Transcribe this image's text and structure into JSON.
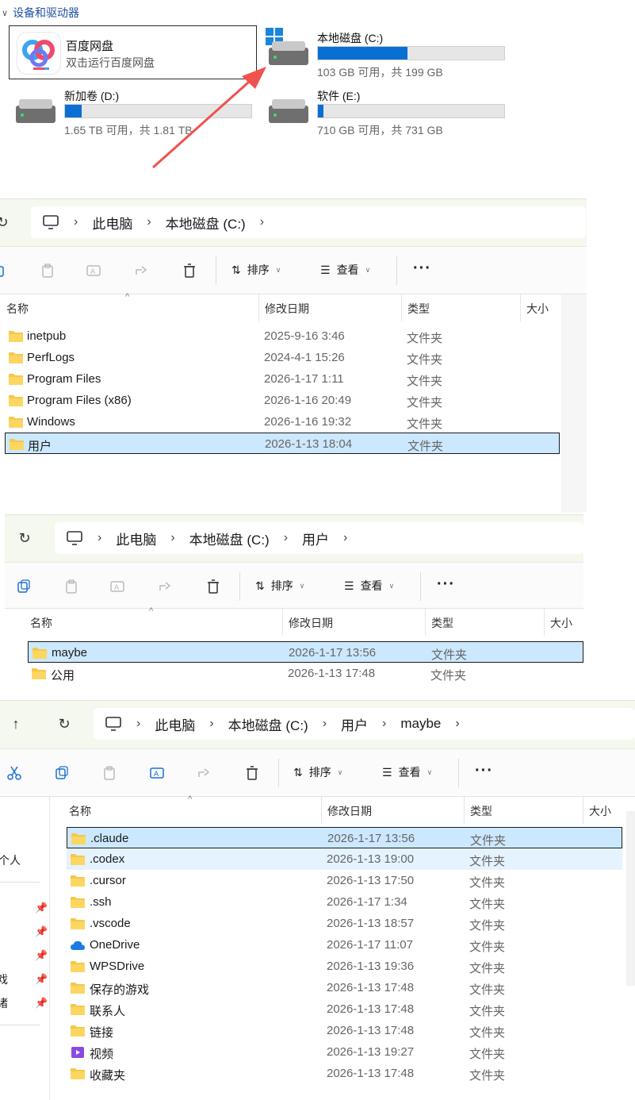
{
  "drives_section": {
    "header": "设备和驱动器",
    "baidu": {
      "name": "百度网盘",
      "subtitle": "双击运行百度网盘"
    },
    "drives": [
      {
        "name": "本地磁盘 (C:)",
        "size": "103 GB 可用，共 199 GB",
        "used_fraction": 0.48
      },
      {
        "name": "新加卷 (D:)",
        "size": "1.65 TB 可用，共 1.81 TB",
        "used_fraction": 0.09
      },
      {
        "name": "软件 (E:)",
        "size": "710 GB 可用，共 731 GB",
        "used_fraction": 0.03
      }
    ],
    "colors": {
      "accent": "#0a6fd2",
      "arrow": "#f0524d"
    }
  },
  "toolbar": {
    "sort_label": "排序",
    "view_label": "查看",
    "more_label": "···"
  },
  "columns": {
    "name": "名称",
    "date": "修改日期",
    "type": "类型",
    "size": "大小"
  },
  "window1": {
    "breadcrumbs": [
      "此电脑",
      "本地磁盘 (C:)"
    ],
    "rows": [
      {
        "name": "inetpub",
        "date": "2025-9-16 3:46",
        "type": "文件夹"
      },
      {
        "name": "PerfLogs",
        "date": "2024-4-1 15:26",
        "type": "文件夹"
      },
      {
        "name": "Program Files",
        "date": "2026-1-17 1:11",
        "type": "文件夹"
      },
      {
        "name": "Program Files (x86)",
        "date": "2026-1-16 20:49",
        "type": "文件夹"
      },
      {
        "name": "Windows",
        "date": "2026-1-16 19:32",
        "type": "文件夹"
      },
      {
        "name": "用户",
        "date": "2026-1-13 18:04",
        "type": "文件夹"
      }
    ]
  },
  "window2": {
    "breadcrumbs": [
      "此电脑",
      "本地磁盘 (C:)",
      "用户"
    ],
    "rows": [
      {
        "name": "maybe",
        "date": "2026-1-17 13:56",
        "type": "文件夹"
      },
      {
        "name": "公用",
        "date": "2026-1-13 17:48",
        "type": "文件夹"
      }
    ]
  },
  "window3": {
    "breadcrumbs": [
      "此电脑",
      "本地磁盘 (C:)",
      "用户",
      "maybe"
    ],
    "sidebar": {
      "items": [
        "个人",
        "戏",
        "诸"
      ]
    },
    "rows": [
      {
        "name": ".claude",
        "date": "2026-1-17 13:56",
        "type": "文件夹",
        "icon": "folder-icon"
      },
      {
        "name": ".codex",
        "date": "2026-1-13 19:00",
        "type": "文件夹",
        "icon": "folder-icon"
      },
      {
        "name": ".cursor",
        "date": "2026-1-13 17:50",
        "type": "文件夹",
        "icon": "folder-icon"
      },
      {
        "name": ".ssh",
        "date": "2026-1-17 1:34",
        "type": "文件夹",
        "icon": "folder-icon"
      },
      {
        "name": ".vscode",
        "date": "2026-1-13 18:57",
        "type": "文件夹",
        "icon": "folder-icon"
      },
      {
        "name": "OneDrive",
        "date": "2026-1-17 11:07",
        "type": "文件夹",
        "icon": "onedrive-cloud-icon"
      },
      {
        "name": "WPSDrive",
        "date": "2026-1-13 19:36",
        "type": "文件夹",
        "icon": "folder-icon"
      },
      {
        "name": "保存的游戏",
        "date": "2026-1-13 17:48",
        "type": "文件夹",
        "icon": "saved-games-icon"
      },
      {
        "name": "联系人",
        "date": "2026-1-13 17:48",
        "type": "文件夹",
        "icon": "contacts-icon"
      },
      {
        "name": "链接",
        "date": "2026-1-13 17:48",
        "type": "文件夹",
        "icon": "links-icon"
      },
      {
        "name": "视频",
        "date": "2026-1-13 19:27",
        "type": "文件夹",
        "icon": "videos-icon"
      },
      {
        "name": "收藏夹",
        "date": "2026-1-13 17:48",
        "type": "文件夹",
        "icon": "favorites-icon"
      }
    ]
  }
}
